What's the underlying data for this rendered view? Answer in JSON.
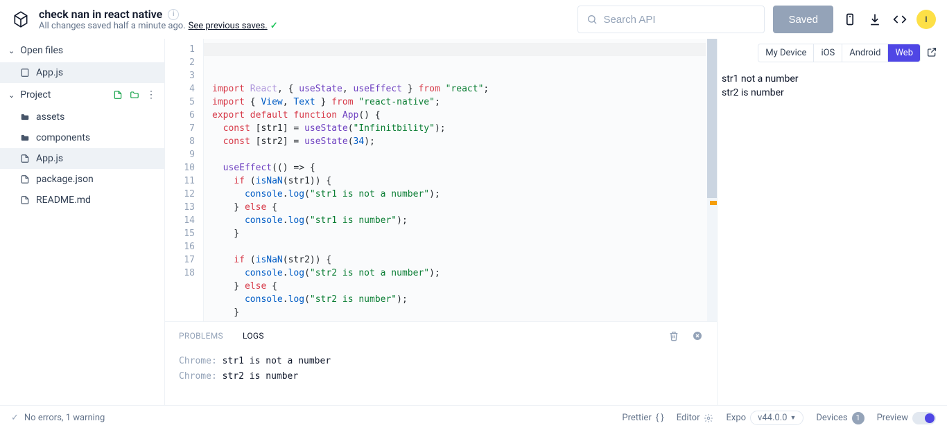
{
  "header": {
    "title": "check nan in react native",
    "subtitle_prefix": "All changes saved half a minute ago. ",
    "subtitle_link": "See previous saves.",
    "search_placeholder": "Search API",
    "saved_label": "Saved",
    "avatar_initial": "I"
  },
  "sidebar": {
    "open_files_label": "Open files",
    "open_files": [
      {
        "name": "App.js",
        "active": true
      }
    ],
    "project_label": "Project",
    "project_items": [
      {
        "name": "assets",
        "type": "folder"
      },
      {
        "name": "components",
        "type": "folder"
      },
      {
        "name": "App.js",
        "type": "file",
        "active": true
      },
      {
        "name": "package.json",
        "type": "file"
      },
      {
        "name": "README.md",
        "type": "file"
      }
    ]
  },
  "editor": {
    "lines": [
      "import React, { useState, useEffect } from \"react\";",
      "import { View, Text } from \"react-native\";",
      "export default function App() {",
      "  const [str1] = useState(\"Infinitbility\");",
      "  const [str2] = useState(34);",
      "",
      "  useEffect(() => {",
      "    if (isNaN(str1)) {",
      "      console.log(\"str1 is not a number\");",
      "    } else {",
      "      console.log(\"str1 is number\");",
      "    }",
      "",
      "    if (isNaN(str2)) {",
      "      console.log(\"str2 is not a number\");",
      "    } else {",
      "      console.log(\"str2 is number\");",
      "    }"
    ]
  },
  "console": {
    "tabs": [
      "PROBLEMS",
      "LOGS"
    ],
    "active_tab": "LOGS",
    "logs": [
      {
        "source": "Chrome:",
        "message": "str1 is not a number"
      },
      {
        "source": "Chrome:",
        "message": "str2 is number"
      }
    ]
  },
  "preview": {
    "platforms": [
      "My Device",
      "iOS",
      "Android",
      "Web"
    ],
    "active_platform": "Web",
    "output": [
      "str1 not a number",
      "str2 is number"
    ]
  },
  "status": {
    "left": "No errors, 1 warning",
    "prettier": "Prettier",
    "editor": "Editor",
    "expo": "Expo",
    "version": "v44.0.0",
    "devices": "Devices",
    "devices_count": "1",
    "preview": "Preview"
  }
}
